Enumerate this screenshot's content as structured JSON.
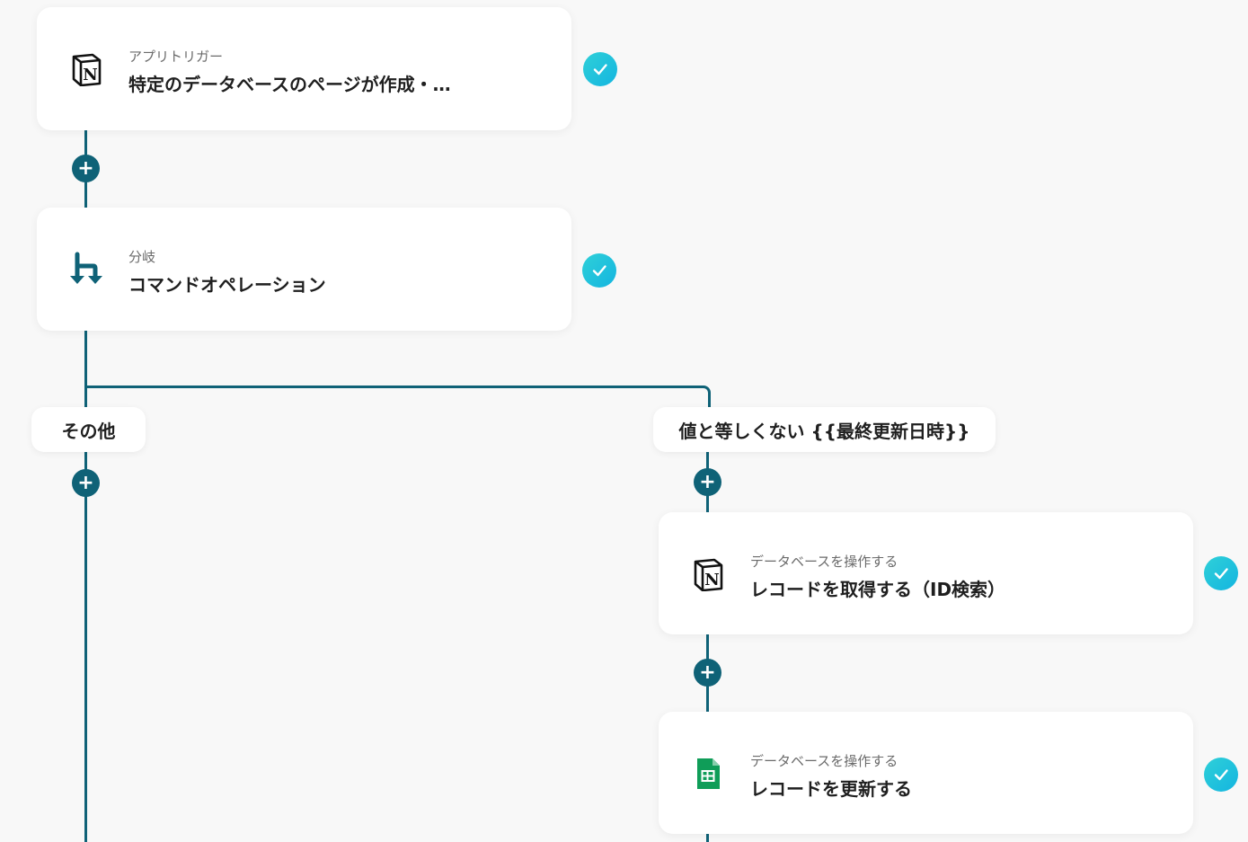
{
  "steps": [
    {
      "subtitle": "アプリトリガー",
      "title": "特定のデータベースのページが作成・…",
      "icon": "notion-icon"
    },
    {
      "subtitle": "分岐",
      "title": "コマンドオペレーション",
      "icon": "branch-icon"
    },
    {
      "subtitle": "データベースを操作する",
      "title": "レコードを取得する（ID検索）",
      "icon": "notion-icon"
    },
    {
      "subtitle": "データベースを操作する",
      "title": "レコードを更新する",
      "icon": "google-sheets-icon"
    }
  ],
  "branches": {
    "left_label": "その他",
    "right_label": "値と等しくない {{最終更新日時}}"
  },
  "add_step_symbol": "+",
  "colors": {
    "connector": "#0f6277",
    "check_gradient_start": "#2fd0d8",
    "check_gradient_end": "#14b5e0",
    "background": "#f8f8f8",
    "sheets_green": "#0f9d58"
  }
}
